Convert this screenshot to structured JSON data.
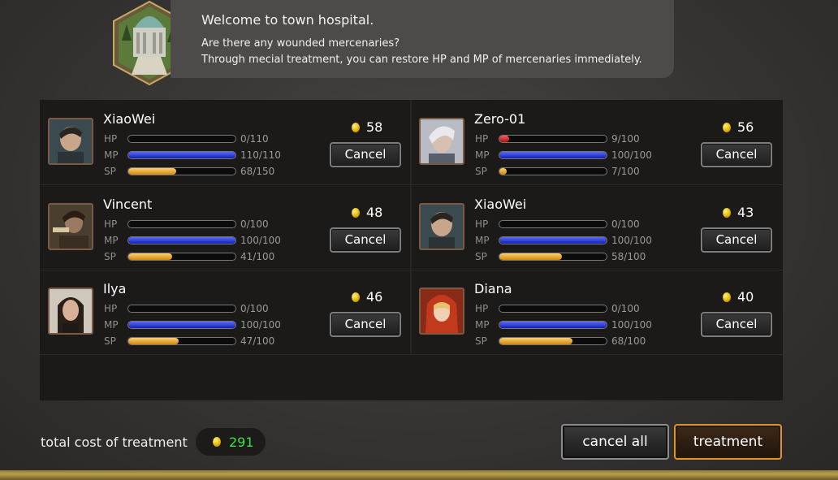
{
  "header": {
    "welcome": "Welcome to town hospital.",
    "line1": "Are there any wounded mercenaries?",
    "line2": "Through mecial treatment, you can restore HP and MP of mercenaries immediately."
  },
  "labels": {
    "hp": "HP",
    "mp": "MP",
    "sp": "SP",
    "cancel": "Cancel"
  },
  "mercenaries": [
    {
      "name": "XiaoWei",
      "cost": "58",
      "hp": "0/110",
      "mp": "110/110",
      "sp": "68/150",
      "hp_pct": 0,
      "mp_pct": 100,
      "sp_pct": 45
    },
    {
      "name": "Zero-01",
      "cost": "56",
      "hp": "9/100",
      "mp": "100/100",
      "sp": "7/100",
      "hp_pct": 9,
      "mp_pct": 100,
      "sp_pct": 7
    },
    {
      "name": "Vincent",
      "cost": "48",
      "hp": "0/100",
      "mp": "100/100",
      "sp": "41/100",
      "hp_pct": 0,
      "mp_pct": 100,
      "sp_pct": 41
    },
    {
      "name": "XiaoWei",
      "cost": "43",
      "hp": "0/100",
      "mp": "100/100",
      "sp": "58/100",
      "hp_pct": 0,
      "mp_pct": 100,
      "sp_pct": 58
    },
    {
      "name": "Ilya",
      "cost": "46",
      "hp": "0/100",
      "mp": "100/100",
      "sp": "47/100",
      "hp_pct": 0,
      "mp_pct": 100,
      "sp_pct": 47
    },
    {
      "name": "Diana",
      "cost": "40",
      "hp": "0/100",
      "mp": "100/100",
      "sp": "68/100",
      "hp_pct": 0,
      "mp_pct": 100,
      "sp_pct": 68
    }
  ],
  "footer": {
    "total_label": "total cost of treatment",
    "total_value": "291",
    "cancel_all": "cancel all",
    "treatment": "treatment"
  }
}
